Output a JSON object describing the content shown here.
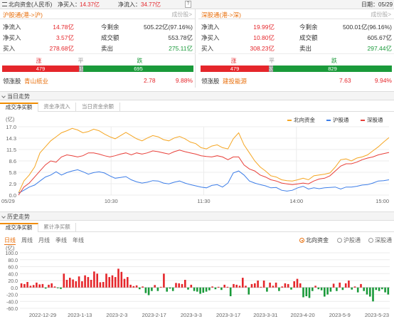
{
  "topbar": {
    "menu_label": "北向资金(人民币)",
    "net_buy_label": "净买入：",
    "net_buy_value": "14.37亿",
    "net_inflow_label": "净流入：",
    "net_inflow_value": "34.77亿",
    "help_glyph": "?",
    "date_text": "日期：05/29"
  },
  "sh_panel": {
    "title": "沪股通(港->沪)",
    "link": "成份股>",
    "rows": [
      {
        "l1": "净流入",
        "v1": "14.78亿",
        "l2": "今剩余",
        "v2": "505.22亿(97.16%)"
      },
      {
        "l1": "净买入",
        "v1": "3.57亿",
        "l2": "成交额",
        "v2": "553.78亿"
      },
      {
        "l1": "买入",
        "v1": "278.68亿",
        "l2": "卖出",
        "v2": "275.11亿"
      }
    ],
    "labels": {
      "up": "涨",
      "flat": "平",
      "down": "跌"
    },
    "counts": {
      "up": "479",
      "flat": "19",
      "down": "695"
    },
    "counts_num": {
      "up": 479,
      "flat": 19,
      "down": 695
    },
    "leader_label": "领涨股",
    "leader_name": "青山纸业",
    "leader_price": "2.78",
    "leader_pct": "9.88%"
  },
  "sz_panel": {
    "title": "深股通(港->深)",
    "link": "成份股>",
    "rows": [
      {
        "l1": "净流入",
        "v1": "19.99亿",
        "l2": "今剩余",
        "v2": "500.01亿(96.16%)"
      },
      {
        "l1": "净买入",
        "v1": "10.80亿",
        "l2": "成交额",
        "v2": "605.67亿"
      },
      {
        "l1": "买入",
        "v1": "308.23亿",
        "l2": "卖出",
        "v2": "297.44亿"
      }
    ],
    "labels": {
      "up": "涨",
      "flat": "平",
      "down": "跌"
    },
    "counts": {
      "up": "479",
      "flat": "31",
      "down": "829"
    },
    "counts_num": {
      "up": 479,
      "flat": 31,
      "down": 829
    },
    "leader_label": "领涨股",
    "leader_name": "建投能源",
    "leader_price": "7.63",
    "leader_pct": "9.94%"
  },
  "intraday": {
    "section_title": "当日走势",
    "tabs": [
      "成交净买额",
      "资金净流入",
      "当日资金余额"
    ],
    "legend": [
      "北向资金",
      "沪股通",
      "深股通"
    ]
  },
  "history": {
    "section_title": "历史走势",
    "tabs": [
      "成交净买额",
      "累计净买额"
    ],
    "periods": [
      "日线",
      "周线",
      "月线",
      "季线",
      "年线"
    ],
    "radios": [
      "北向资金",
      "沪股通",
      "深股通"
    ]
  },
  "colors": {
    "north": "#f5a623",
    "sh": "#3d7ee8",
    "sz": "#e8403a",
    "up": "#e5262b",
    "down": "#1a9a3a",
    "accent": "#e8700e"
  },
  "chart_data": [
    {
      "type": "line",
      "title": "",
      "ylabel": "(亿)",
      "y_ticks": [
        "17.0",
        "14.3",
        "11.5",
        "8.6",
        "5.8",
        "2.9",
        "0.0"
      ],
      "ylim": [
        0,
        17.0
      ],
      "x_ticks": [
        "05/29",
        "10:30",
        "11:30",
        "14:00",
        "15:00"
      ],
      "grid": true,
      "legend_position": "top-right",
      "series": [
        {
          "name": "北向资金",
          "values": [
            0.5,
            3.5,
            5.0,
            7.0,
            10.5,
            12.0,
            13.5,
            14.5,
            15.5,
            16.0,
            16.6,
            16.2,
            15.5,
            15.8,
            16.4,
            16.0,
            15.2,
            14.5,
            14.0,
            14.8,
            15.6,
            14.8,
            14.0,
            13.5,
            14.2,
            14.8,
            14.5,
            13.8,
            13.5,
            14.2,
            14.6,
            14.0,
            13.2,
            12.8,
            11.8,
            11.5,
            12.2,
            12.5,
            11.8,
            11.5,
            14.0,
            15.5,
            12.5,
            10.5,
            8.5,
            7.0,
            6.0,
            4.8,
            4.5,
            3.8,
            3.6,
            3.5,
            3.8,
            4.2,
            3.8,
            4.8,
            5.0,
            5.2,
            5.5,
            7.0,
            8.8,
            9.0,
            8.5,
            9.2,
            9.5,
            10.0,
            11.0,
            12.0,
            13.2,
            14.3
          ]
        },
        {
          "name": "沪股通",
          "values": [
            0.5,
            1.2,
            2.0,
            2.5,
            3.5,
            4.5,
            5.0,
            5.8,
            5.0,
            5.6,
            6.0,
            6.3,
            5.8,
            5.2,
            5.6,
            5.8,
            5.5,
            4.8,
            4.2,
            4.4,
            4.6,
            3.8,
            3.3,
            3.0,
            3.2,
            3.6,
            3.5,
            3.0,
            2.8,
            3.2,
            3.5,
            3.0,
            2.6,
            2.3,
            2.0,
            1.8,
            2.4,
            2.6,
            2.0,
            3.0,
            5.5,
            6.0,
            5.0,
            3.5,
            3.0,
            2.6,
            2.3,
            1.8,
            1.9,
            1.2,
            1.0,
            1.2,
            1.8,
            2.2,
            1.5,
            1.8,
            1.6,
            1.8,
            1.9,
            2.0,
            1.5,
            2.0,
            2.0,
            2.2,
            2.5,
            2.6,
            3.0,
            3.5,
            3.6,
            3.8
          ]
        },
        {
          "name": "深股通",
          "values": [
            0.0,
            2.0,
            3.0,
            4.5,
            6.0,
            7.5,
            8.5,
            8.2,
            9.5,
            10.0,
            9.8,
            9.5,
            9.8,
            10.5,
            10.5,
            10.2,
            9.8,
            9.5,
            9.8,
            10.2,
            10.5,
            10.0,
            10.5,
            10.2,
            10.5,
            11.0,
            10.8,
            10.5,
            10.2,
            10.8,
            11.2,
            10.8,
            10.5,
            10.2,
            9.8,
            9.6,
            9.5,
            9.8,
            9.5,
            8.8,
            9.5,
            9.5,
            7.5,
            6.5,
            6.0,
            5.0,
            4.5,
            3.8,
            3.5,
            3.0,
            2.8,
            2.6,
            2.8,
            3.0,
            2.8,
            3.5,
            4.0,
            4.2,
            4.8,
            6.0,
            7.2,
            7.8,
            7.8,
            8.2,
            8.8,
            9.2,
            9.5,
            10.0,
            10.3,
            10.6
          ]
        }
      ]
    },
    {
      "type": "bar",
      "title": "",
      "ylabel": "(亿)",
      "y_ticks": [
        "100.0",
        "80.0",
        "60.0",
        "40.0",
        "20.0",
        "0.0",
        "-20.0",
        "-40.0",
        "-60.0"
      ],
      "ylim": [
        -60,
        100
      ],
      "x_ticks": [
        "2022-12-29",
        "2023-1-13",
        "2023-2-3",
        "2023-2-17",
        "2023-3-3",
        "2023-3-17",
        "2023-3-31",
        "2023-4-20",
        "2023-5-9",
        "2023-5-23"
      ],
      "grid": true,
      "series": [
        {
          "name": "北向资金",
          "values": [
            12,
            10,
            16,
            5,
            7,
            14,
            9,
            10,
            -3,
            8,
            12,
            3,
            -2,
            -4,
            40,
            22,
            28,
            23,
            18,
            32,
            18,
            35,
            30,
            22,
            46,
            40,
            15,
            16,
            40,
            30,
            35,
            30,
            54,
            45,
            25,
            30,
            8,
            4,
            6,
            -5,
            3,
            -16,
            -22,
            -10,
            7,
            -10,
            2,
            40,
            -12,
            -3,
            -10,
            13,
            12,
            10,
            22,
            -6,
            8,
            -10,
            -12,
            -18,
            -15,
            -12,
            -8,
            3,
            -5,
            2,
            -7,
            8,
            2,
            -25,
            10,
            8,
            5,
            28,
            5,
            -20,
            10,
            12,
            20,
            2,
            20,
            -12,
            14,
            5,
            14,
            -10,
            3,
            12,
            10,
            -6,
            18,
            25,
            12,
            -28,
            -25,
            -30,
            -10,
            5,
            -5,
            -8,
            -26,
            -20,
            -12,
            11,
            -10,
            14,
            -7,
            12,
            20,
            -6,
            3,
            -14,
            10,
            -10,
            -20,
            -26,
            -40,
            -7,
            -10,
            -5,
            -14,
            -20
          ]
        }
      ]
    }
  ]
}
